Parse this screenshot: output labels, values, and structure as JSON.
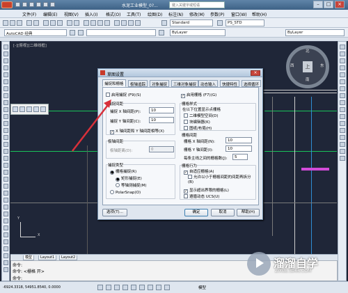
{
  "window": {
    "title": "水泥工业模型_0?...",
    "search_placeholder": "键入关键字或短语"
  },
  "menu": [
    "文件(F)",
    "编辑(E)",
    "视图(V)",
    "插入(I)",
    "格式(O)",
    "工具(T)",
    "绘图(D)",
    "标注(N)",
    "修改(M)",
    "参数(P)",
    "窗口(W)",
    "帮助(H)"
  ],
  "toolbar": {
    "workspace": "AutoCAD 经典",
    "text_style": "Standard",
    "dim_style": "PS_STD",
    "color": "ByLayer",
    "linetype": "ByLayer"
  },
  "viewport_label": "[-][俯视][二维线框]",
  "viewcube": {
    "north": "北",
    "south": "南",
    "east": "东",
    "west": "西",
    "top": "上"
  },
  "dialog": {
    "title": "草图设置",
    "close": "×",
    "tabs": [
      "捕捉和栅格",
      "极轴追踪",
      "对象捕捉",
      "三维对象捕捉",
      "动态输入",
      "快捷特性",
      "选择循环"
    ],
    "snap_on": "启用捕捉 (F9)(S)",
    "grid_on": "启用栅格 (F7)(G)",
    "snap_spacing": {
      "title": "捕捉间距",
      "x_label": "捕捉 X 轴间距(P):",
      "x_value": "10",
      "y_label": "捕捉 Y 轴间距(C):",
      "y_value": "10",
      "equal": "X 轴间距和 Y 轴间距相等(X)"
    },
    "polar_spacing": {
      "title": "极轴间距",
      "label": "极轴距离(D):",
      "value": "0"
    },
    "snap_type": {
      "title": "捕捉类型",
      "grid_snap": "栅格捕捉(R)",
      "rect_snap": "矩形捕捉(E)",
      "iso_snap": "等轴测捕捉(M)",
      "polar_snap": "PolarSnap(O)"
    },
    "grid_style": {
      "title": "栅格样式",
      "desc": "在以下位置显示点栅格",
      "opt1": "二维模型空间(D)",
      "opt2": "块编辑器(K)",
      "opt3": "图纸/布局(H)"
    },
    "grid_spacing": {
      "title": "栅格间距",
      "x_label": "栅格 X 轴间距(N):",
      "x_value": "10",
      "y_label": "栅格 Y 轴间距(I):",
      "y_value": "10",
      "major_label": "每条主线之间的栅格数(J):",
      "major_value": "5"
    },
    "grid_behavior": {
      "title": "栅格行为",
      "adaptive": "自适应栅格(A)",
      "subdivide": "允许以小于栅格间距的间距再拆分(B)",
      "beyond": "显示超出界限的栅格(L)",
      "follow": "遵循动态 UCS(U)"
    },
    "options_btn": "选项(T)...",
    "ok_btn": "确定",
    "cancel_btn": "取消",
    "help_btn": "帮助(H)"
  },
  "layout_tabs": [
    "模型",
    "Layout1",
    "Layout2"
  ],
  "command": {
    "line1": "命令:",
    "line2": "命令: <栅格 开>",
    "prompt": "命令:"
  },
  "status": {
    "coords": "-6924.3318, 54951.8540, 0.0000",
    "model": "模型"
  },
  "watermark": {
    "brand": "溜溜自学",
    "url": "ZIXUE.3D66.COM"
  },
  "colors": {
    "accent": "#d8303a",
    "grid_green": "#19c45a",
    "canvas": "#1f2638"
  }
}
